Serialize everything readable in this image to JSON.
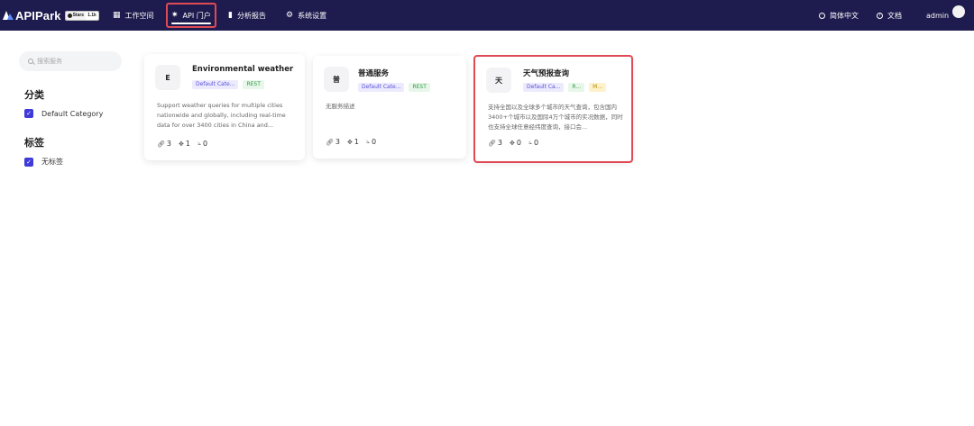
{
  "app": {
    "name": "APIPark",
    "badge_left": "Stars",
    "badge_right": "1.1k"
  },
  "nav": {
    "items": [
      {
        "label": "工作空间",
        "icon": "workspace-icon"
      },
      {
        "label": "API 门户",
        "icon": "portal-icon",
        "active": true
      },
      {
        "label": "分析报告",
        "icon": "chart-icon"
      },
      {
        "label": "系统设置",
        "icon": "gear-icon"
      }
    ],
    "language": "简体中文",
    "docs": "文档",
    "user": "admin"
  },
  "sidebar": {
    "search_placeholder": "搜索服务",
    "category_heading": "分类",
    "categories": [
      "Default Category"
    ],
    "tag_heading": "标签",
    "tags": [
      "无标签"
    ]
  },
  "cards": [
    {
      "initial": "E",
      "title": "Environmental weather quer",
      "tags": [
        "Default Cate...",
        "REST"
      ],
      "description": "Support weather queries for multiple cities nationwide and globally, including real-time data for over 3400 cities in China and...",
      "stats": {
        "apis": "3",
        "subscribers": "1",
        "calls": "0"
      }
    },
    {
      "initial": "普",
      "title": "普通服务",
      "tags": [
        "Default Cate...",
        "REST"
      ],
      "description": "无服务描述",
      "stats": {
        "apis": "3",
        "subscribers": "1",
        "calls": "0"
      }
    },
    {
      "initial": "天",
      "title": "天气预报查询",
      "tags": [
        "Default Ca...",
        "R...",
        "M..."
      ],
      "description": "支持全国以及全球多个城市的天气查询，包含国内3400+个城市以及国际4万个城市的实况数据，同时也支持全球任意经纬度查询，接口会...",
      "stats": {
        "apis": "3",
        "subscribers": "0",
        "calls": "0"
      }
    }
  ],
  "colors": {
    "topbar": "#1e1b4e",
    "accent": "#3f3ad8",
    "highlight": "#e04a55"
  }
}
